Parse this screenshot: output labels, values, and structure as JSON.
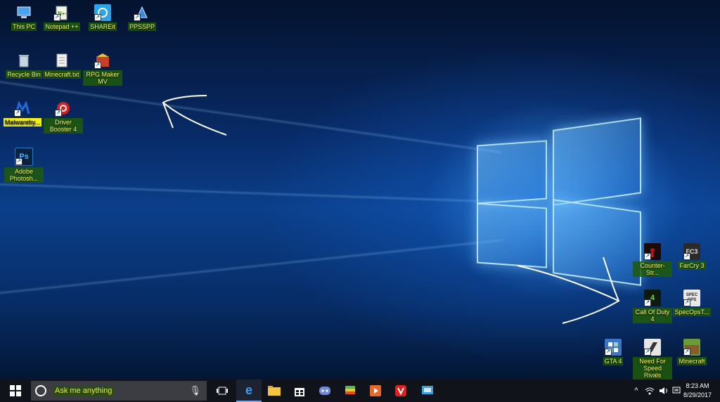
{
  "desktop": {
    "icons": [
      {
        "label": "This PC",
        "icon": "computer-icon",
        "color": "#4aa3f0"
      },
      {
        "label": "Notepad ++",
        "icon": "notepad-icon",
        "color": "#8ac34a"
      },
      {
        "label": "SHAREit",
        "icon": "shareit-icon",
        "color": "#2aa6e8"
      },
      {
        "label": "PPSSPP",
        "icon": "ppsspp-icon",
        "color": "#3a8ad8"
      },
      {
        "label": "Recycle Bin",
        "icon": "recycle-bin-icon",
        "color": "#9fb6c8"
      },
      {
        "label": "Minecraft.txt",
        "icon": "text-file-icon",
        "color": "#f2f2f2"
      },
      {
        "label": "RPG Maker MV",
        "icon": "rpg-maker-icon",
        "color": "#c8402a"
      },
      {
        "label": "Malwareby...",
        "icon": "malwarebytes-icon",
        "color": "#1e6ad6"
      },
      {
        "label": "Driver Booster 4",
        "icon": "driver-booster-icon",
        "color": "#d42020"
      },
      {
        "label": "Adobe Photosh...",
        "icon": "photoshop-icon",
        "color": "#1d79c8"
      },
      {
        "label": "Counter-Str...",
        "icon": "counter-strike-icon",
        "color": "#b01818"
      },
      {
        "label": "FarCry 3",
        "icon": "farcry-icon",
        "color": "#2a2a2a"
      },
      {
        "label": "Call Of Duty 4",
        "icon": "call-of-duty-icon",
        "color": "#1f6b1f"
      },
      {
        "label": "SpecOpsT...",
        "icon": "spec-ops-icon",
        "color": "#e8e8e8"
      },
      {
        "label": "GTA 4",
        "icon": "gta-icon",
        "color": "#3b76c6"
      },
      {
        "label": "Need For Speed Rivals",
        "icon": "need-for-speed-icon",
        "color": "#e6e6e6"
      },
      {
        "label": "Minecraft",
        "icon": "minecraft-icon",
        "color": "#6a9a3a"
      }
    ]
  },
  "taskbar": {
    "search_placeholder": "Ask me anything",
    "apps": [
      {
        "name": "task-view",
        "icon": "task-view-icon"
      },
      {
        "name": "edge",
        "icon": "edge-icon"
      },
      {
        "name": "file-explorer",
        "icon": "folder-icon"
      },
      {
        "name": "store",
        "icon": "store-icon"
      },
      {
        "name": "discord",
        "icon": "discord-icon"
      },
      {
        "name": "bluestacks",
        "icon": "bluestacks-icon"
      },
      {
        "name": "media-player",
        "icon": "media-player-icon"
      },
      {
        "name": "vivaldi",
        "icon": "vivaldi-icon"
      },
      {
        "name": "remote-app",
        "icon": "remote-app-icon"
      }
    ],
    "tray": {
      "chevron": "^",
      "time": "8:23 AM",
      "date": "8/29/2017"
    }
  },
  "colors": {
    "highlight_green": "#1e5a0a",
    "highlight_yellow": "#f2f21a",
    "label_yellow": "#f4f46a",
    "taskbar_bg": "#10131a"
  }
}
